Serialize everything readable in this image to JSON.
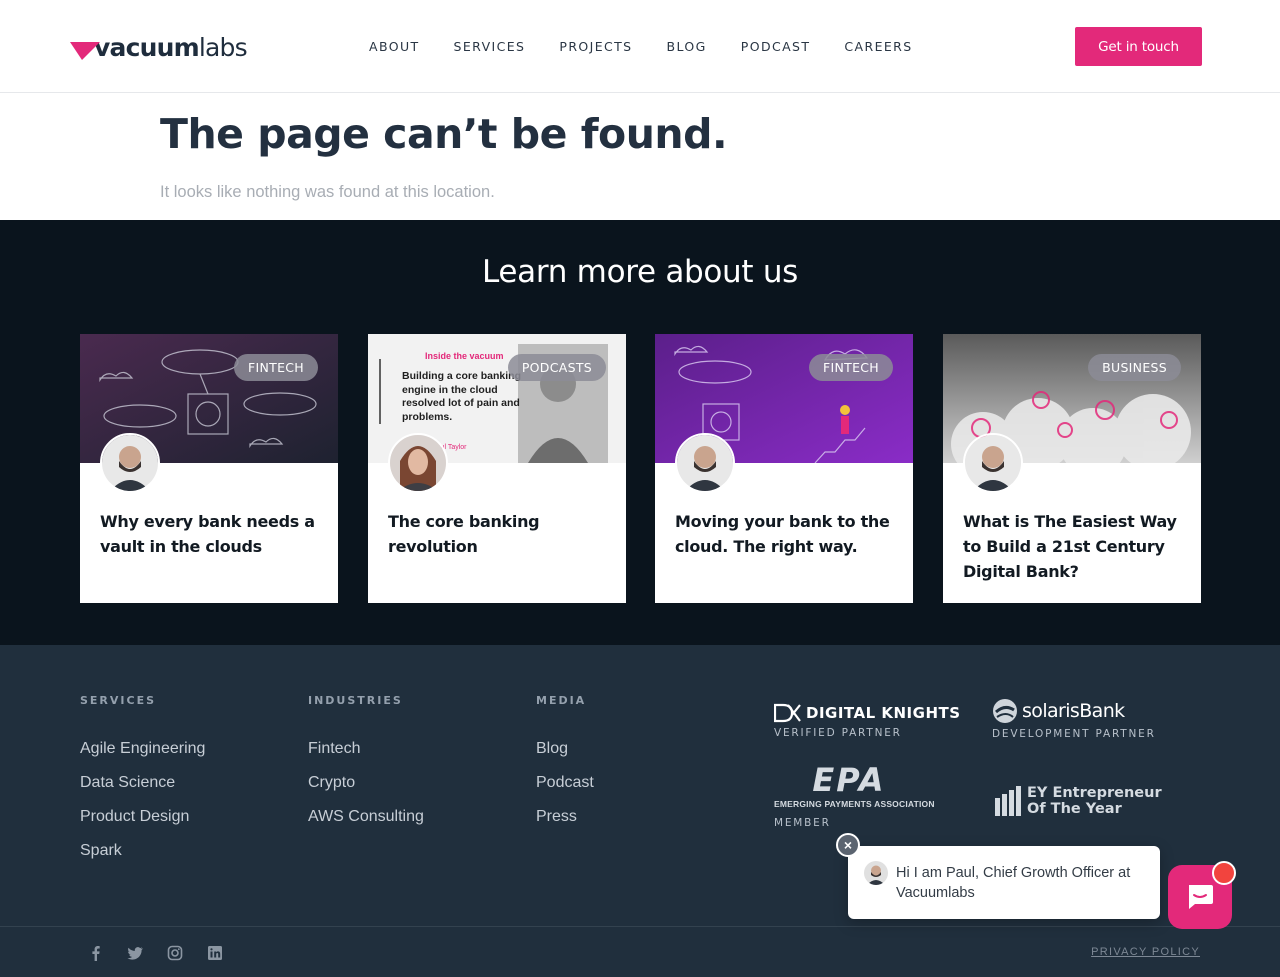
{
  "header": {
    "logo": {
      "bold": "vacuum",
      "light": "labs"
    },
    "nav": [
      "ABOUT",
      "SERVICES",
      "PROJECTS",
      "BLOG",
      "PODCAST",
      "CAREERS"
    ],
    "cta": "Get in touch",
    "accent": "#e3297a"
  },
  "notfound": {
    "title": "The page can’t be found.",
    "subtitle": "It looks like nothing was found at this location."
  },
  "learn": {
    "title": "Learn more about us",
    "cards": [
      {
        "tag": "FINTECH",
        "title": "Why every bank needs a vault in the clouds",
        "image": "airships-vault-illustration"
      },
      {
        "tag": "PODCASTS",
        "title": "The core banking revolution",
        "image": "podcast-cover-inside-the-vacuum",
        "image_text": {
          "kicker": "Inside the vacuum",
          "quote": "Building a core banking engine in the cloud resolved lot of pain and problems.",
          "byline": "Paul Taylor"
        }
      },
      {
        "tag": "FINTECH",
        "title": "Moving your bank to the cloud. The right way.",
        "image": "purple-cloud-migration-illustration"
      },
      {
        "tag": "BUSINESS",
        "title": "What is The Easiest Way to Build a 21st Century Digital Bank?",
        "image": "clouds-with-currency-icons"
      }
    ]
  },
  "footer": {
    "columns": [
      {
        "heading": "SERVICES",
        "links": [
          "Agile Engineering",
          "Data Science",
          "Product Design",
          "Spark"
        ]
      },
      {
        "heading": "INDUSTRIES",
        "links": [
          "Fintech",
          "Crypto",
          "AWS Consulting"
        ]
      },
      {
        "heading": "MEDIA",
        "links": [
          "Blog",
          "Podcast",
          "Press"
        ]
      }
    ],
    "partners": [
      {
        "name": "DIGITAL KNIGHTS",
        "sub": "VERIFIED PARTNER"
      },
      {
        "name": "solarisBank",
        "sub": "DEVELOPMENT PARTNER"
      },
      {
        "name": "EPA",
        "full": "EMERGING PAYMENTS ASSOCIATION",
        "sub": "MEMBER"
      },
      {
        "name": "EY Entrepreneur Of The Year",
        "line1": "EY Entrepreneur",
        "line2": "Of The Year",
        "sub": ""
      }
    ],
    "social": [
      "facebook-icon",
      "twitter-icon",
      "instagram-icon",
      "linkedin-icon"
    ],
    "privacy": "PRIVACY POLICY"
  },
  "chat": {
    "message": "Hi I am Paul, Chief Growth Officer at Vacuumlabs",
    "close": "×"
  }
}
